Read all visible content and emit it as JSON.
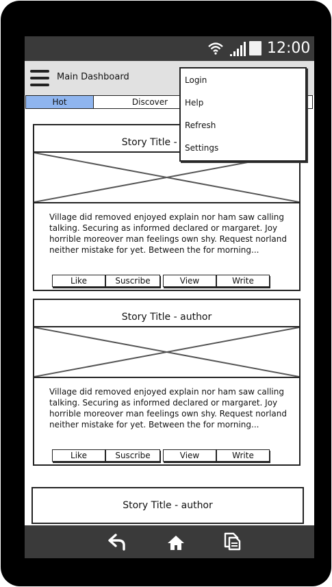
{
  "status_bar": {
    "time": "12:00",
    "wifi_icon": "wifi-icon",
    "signal_icon": "signal-icon",
    "battery_icon": "battery-icon"
  },
  "app_bar": {
    "menu_icon": "hamburger-icon",
    "title": "Main Dashboard"
  },
  "tabs": [
    {
      "label": "Hot",
      "active": true
    },
    {
      "label": "Discover",
      "active": false
    },
    {
      "label": "",
      "active": false
    }
  ],
  "overflow_menu": {
    "items": [
      {
        "label": "Login"
      },
      {
        "label": "Help"
      },
      {
        "label": "Refresh"
      },
      {
        "label": "Settings"
      }
    ]
  },
  "stories": [
    {
      "title": "Story Title - author",
      "description": "Village did removed enjoyed explain nor ham saw calling talking. Securing as informed declared or margaret. Joy horrible moreover man feelings own shy. Request norland neither mistake for yet. Between the for morning...",
      "actions": [
        "Like",
        "Suscribe",
        "View",
        "Write"
      ]
    },
    {
      "title": "Story Title - author",
      "description": "Village did removed enjoyed explain nor ham saw calling talking. Securing as informed declared or margaret. Joy horrible moreover man feelings own shy. Request norland neither mistake for yet. Between the for morning...",
      "actions": [
        "Like",
        "Suscribe",
        "View",
        "Write"
      ]
    },
    {
      "title": "Story Title - author"
    }
  ],
  "nav_bar": {
    "items": [
      {
        "icon": "back-icon"
      },
      {
        "icon": "home-icon"
      },
      {
        "icon": "recent-apps-icon"
      }
    ]
  },
  "colors": {
    "active_tab": "#8fb5ef",
    "status_bar": "#3a3a3a",
    "app_bar": "#e1e1e1",
    "frame": "#000000"
  }
}
